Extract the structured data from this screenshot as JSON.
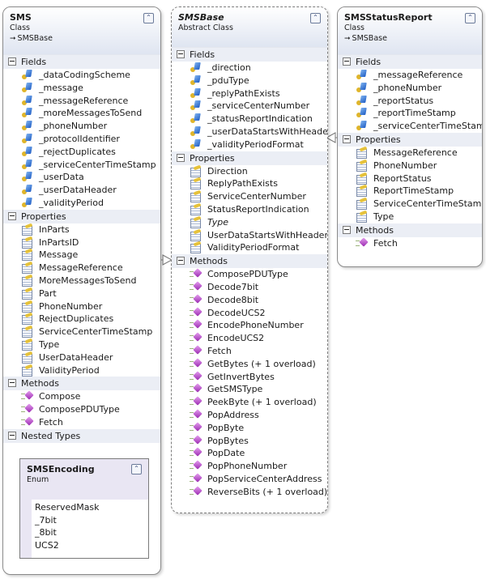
{
  "diagram": {
    "type": "class-diagram",
    "shapes": {
      "sms": {
        "name": "SMS",
        "kind": "Class",
        "base": "SMSBase",
        "sections": {
          "fields": {
            "label": "Fields",
            "items": [
              "_dataCodingScheme",
              "_message",
              "_messageReference",
              "_moreMessagesToSend",
              "_phoneNumber",
              "_protocolIdentifier",
              "_rejectDuplicates",
              "_serviceCenterTimeStamp",
              "_userData",
              "_userDataHeader",
              "_validityPeriod"
            ]
          },
          "properties": {
            "label": "Properties",
            "items": [
              "InParts",
              "InPartsID",
              "Message",
              "MessageReference",
              "MoreMessagesToSend",
              "Part",
              "PhoneNumber",
              "RejectDuplicates",
              "ServiceCenterTimeStamp",
              "Type",
              "UserDataHeader",
              "ValidityPeriod"
            ]
          },
          "methods": {
            "label": "Methods",
            "items": [
              "Compose",
              "ComposePDUType",
              "Fetch"
            ]
          },
          "nested": {
            "label": "Nested Types"
          }
        },
        "nested_type": {
          "name": "SMSEncoding",
          "kind": "Enum",
          "items": [
            "ReservedMask",
            "_7bit",
            "_8bit",
            "UCS2"
          ]
        }
      },
      "smsbase": {
        "name": "SMSBase",
        "kind": "Abstract Class",
        "sections": {
          "fields": {
            "label": "Fields",
            "items": [
              "_direction",
              "_pduType",
              "_replyPathExists",
              "_serviceCenterNumber",
              "_statusReportIndication",
              "_userDataStartsWithHeader",
              "_validityPeriodFormat"
            ]
          },
          "properties": {
            "label": "Properties",
            "items": [
              "Direction",
              "ReplyPathExists",
              "ServiceCenterNumber",
              "StatusReportIndication",
              "Type",
              "UserDataStartsWithHeader",
              "ValidityPeriodFormat"
            ],
            "italic_items": [
              "Type"
            ]
          },
          "methods": {
            "label": "Methods",
            "items": [
              "ComposePDUType",
              "Decode7bit",
              "Decode8bit",
              "DecodeUCS2",
              "EncodePhoneNumber",
              "EncodeUCS2",
              "Fetch",
              "GetBytes (+ 1 overload)",
              "GetInvertBytes",
              "GetSMSType",
              "PeekByte (+ 1 overload)",
              "PopAddress",
              "PopByte",
              "PopBytes",
              "PopDate",
              "PopPhoneNumber",
              "PopServiceCenterAddress",
              "ReverseBits (+ 1 overload)"
            ]
          }
        }
      },
      "smsstatusreport": {
        "name": "SMSStatusReport",
        "kind": "Class",
        "base": "SMSBase",
        "sections": {
          "fields": {
            "label": "Fields",
            "items": [
              "_messageReference",
              "_phoneNumber",
              "_reportStatus",
              "_reportTimeStamp",
              "_serviceCenterTimeStamp"
            ]
          },
          "properties": {
            "label": "Properties",
            "items": [
              "MessageReference",
              "PhoneNumber",
              "ReportStatus",
              "ReportTimeStamp",
              "ServiceCenterTimeStamp",
              "Type"
            ]
          },
          "methods": {
            "label": "Methods",
            "items": [
              "Fetch"
            ]
          }
        }
      }
    },
    "relations": [
      {
        "from": "SMS",
        "to": "SMSBase",
        "type": "inheritance"
      },
      {
        "from": "SMSStatusReport",
        "to": "SMSBase",
        "type": "inheritance"
      }
    ],
    "icons": {
      "field": "field-icon",
      "property": "property-icon",
      "method": "method-icon",
      "collapse": "collapse-chevron-icon",
      "section_toggle": "minus-toggle-icon",
      "inherits": "inheritance-arrow-icon"
    },
    "colors": {
      "header_gradient_end": "#dfe5f1",
      "section_header": "#ebeef5",
      "nested_bg": "#e9e6f3",
      "border": "#8a8a8a"
    }
  }
}
